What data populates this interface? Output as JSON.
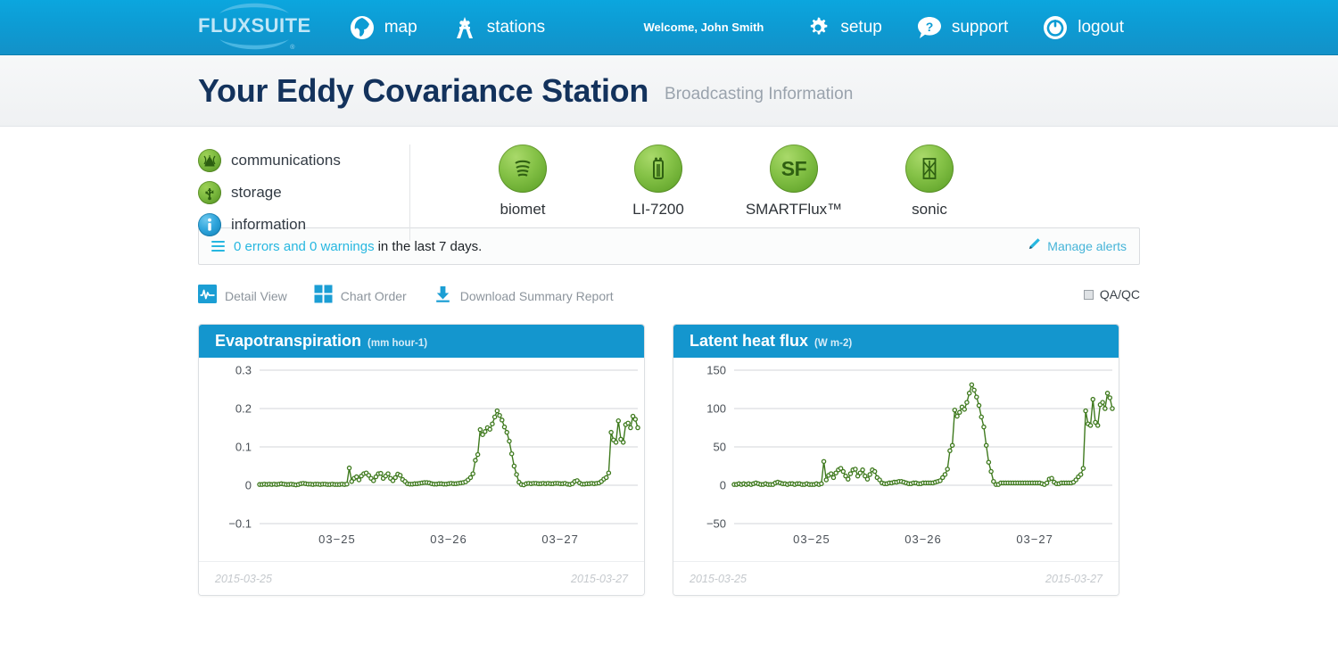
{
  "nav": {
    "logo_text": "FLUXSUITE",
    "logo_mark": "swoosh-logo",
    "items": [
      {
        "label": "map",
        "icon": "globe-icon"
      },
      {
        "label": "stations",
        "icon": "stations-icon"
      }
    ],
    "welcome": "Welcome, John Smith",
    "right_items": [
      {
        "label": "setup",
        "icon": "gear-icon"
      },
      {
        "label": "support",
        "icon": "question-bubble-icon"
      },
      {
        "label": "logout",
        "icon": "power-icon"
      }
    ]
  },
  "page": {
    "title": "Your Eddy Covariance Station",
    "subtitle": "Broadcasting Information"
  },
  "status": {
    "items": [
      {
        "label": "communications",
        "icon": "antenna-icon",
        "state_color": "#7cba3f"
      },
      {
        "label": "storage",
        "icon": "usb-icon",
        "state_color": "#7cba3f"
      },
      {
        "label": "information",
        "icon": "info-icon",
        "state_color": "#2fa5dc"
      }
    ]
  },
  "devices": [
    {
      "label": "biomet",
      "icon": "biomet-icon",
      "state_color": "#85c247"
    },
    {
      "label": "LI-7200",
      "icon": "gas-analyzer-icon",
      "state_color": "#85c247"
    },
    {
      "label": "SMARTFlux™",
      "icon": "sf-icon",
      "badge_text": "SF",
      "state_color": "#85c247"
    },
    {
      "label": "sonic",
      "icon": "sonic-anemometer-icon",
      "state_color": "#85c247"
    }
  ],
  "alerts": {
    "menu_icon": "hamburger-icon",
    "highlight": "0 errors and 0 warnings",
    "rest": "in the last 7 days.",
    "manage_icon": "pencil-icon",
    "manage_label": "Manage alerts",
    "link_color": "#27b7e0"
  },
  "toolbar": {
    "items": [
      {
        "label": "Detail View",
        "icon": "waveform-icon"
      },
      {
        "label": "Chart Order",
        "icon": "grid-squares-icon"
      },
      {
        "label": "Download Summary Report",
        "icon": "download-icon"
      }
    ],
    "qaqc_label": "QA/QC",
    "qaqc_checked": false
  },
  "chart_data": [
    {
      "type": "line",
      "title": "Evapotranspiration",
      "unit": "(mm hour-1)",
      "xlabel": "",
      "ylabel": "",
      "ylim": [
        -0.1,
        0.3
      ],
      "yticks": [
        0.3,
        0.2,
        0.1,
        0,
        -0.1
      ],
      "ytick_labels": [
        "0.3",
        "0.2",
        "0.1",
        "0",
        "−0.1"
      ],
      "xticks": [
        "03−25",
        "03−26",
        "03−27"
      ],
      "grid": true,
      "legend": "none",
      "line_color": "#3f7a1e",
      "start_date": "2015-03-25",
      "end_date": "2015-03-27",
      "values": [
        0.002,
        0.002,
        0.003,
        0.002,
        0.003,
        0.002,
        0.003,
        0.002,
        0.003,
        0.004,
        0.003,
        0.002,
        0.002,
        0.003,
        0.002,
        0.001,
        0.002,
        0.004,
        0.005,
        0.004,
        0.003,
        0.003,
        0.002,
        0.003,
        0.003,
        0.002,
        0.003,
        0.003,
        0.002,
        0.002,
        0.003,
        0.002,
        0.002,
        0.002,
        0.003,
        0.002,
        0.003,
        0.045,
        0.01,
        0.018,
        0.022,
        0.014,
        0.024,
        0.03,
        0.032,
        0.026,
        0.018,
        0.012,
        0.022,
        0.03,
        0.031,
        0.018,
        0.024,
        0.03,
        0.018,
        0.012,
        0.02,
        0.029,
        0.026,
        0.015,
        0.01,
        0.004,
        0.003,
        0.003,
        0.004,
        0.004,
        0.005,
        0.006,
        0.007,
        0.007,
        0.006,
        0.004,
        0.003,
        0.003,
        0.004,
        0.004,
        0.003,
        0.003,
        0.004,
        0.005,
        0.004,
        0.004,
        0.005,
        0.006,
        0.007,
        0.009,
        0.014,
        0.02,
        0.03,
        0.065,
        0.08,
        0.145,
        0.132,
        0.14,
        0.15,
        0.146,
        0.16,
        0.178,
        0.194,
        0.182,
        0.17,
        0.152,
        0.138,
        0.115,
        0.082,
        0.05,
        0.028,
        0.008,
        0.002,
        0.001,
        0.004,
        0.005,
        0.004,
        0.005,
        0.005,
        0.004,
        0.004,
        0.005,
        0.004,
        0.005,
        0.004,
        0.004,
        0.005,
        0.005,
        0.004,
        0.004,
        0.005,
        0.003,
        0.002,
        0.004,
        0.01,
        0.012,
        0.006,
        0.003,
        0.003,
        0.004,
        0.004,
        0.005,
        0.004,
        0.005,
        0.006,
        0.01,
        0.016,
        0.02,
        0.032,
        0.138,
        0.118,
        0.112,
        0.168,
        0.12,
        0.112,
        0.158,
        0.162,
        0.15,
        0.18,
        0.172,
        0.15
      ]
    },
    {
      "type": "line",
      "title": "Latent heat flux",
      "unit": "(W m-2)",
      "xlabel": "",
      "ylabel": "",
      "ylim": [
        -50,
        150
      ],
      "yticks": [
        150,
        100,
        50,
        0,
        -50
      ],
      "ytick_labels": [
        "150",
        "100",
        "50",
        "0",
        "−50"
      ],
      "xticks": [
        "03−25",
        "03−26",
        "03−27"
      ],
      "grid": true,
      "legend": "none",
      "line_color": "#3f7a1e",
      "start_date": "2015-03-25",
      "end_date": "2015-03-27",
      "values": [
        1,
        1,
        2,
        1,
        2,
        1,
        2,
        1,
        2,
        3,
        2,
        1,
        1,
        2,
        1,
        1,
        1,
        3,
        4,
        3,
        2,
        2,
        1,
        2,
        2,
        1,
        2,
        2,
        1,
        1,
        2,
        1,
        1,
        1,
        2,
        1,
        2,
        31,
        7,
        13,
        15,
        10,
        16,
        20,
        22,
        18,
        12,
        8,
        15,
        20,
        21,
        12,
        16,
        20,
        12,
        8,
        14,
        20,
        18,
        10,
        7,
        3,
        2,
        2,
        3,
        3,
        4,
        4,
        5,
        5,
        4,
        3,
        2,
        2,
        3,
        3,
        2,
        2,
        3,
        3,
        3,
        3,
        3,
        4,
        5,
        6,
        10,
        14,
        21,
        45,
        52,
        98,
        90,
        95,
        102,
        99,
        108,
        120,
        131,
        124,
        115,
        104,
        89,
        76,
        52,
        30,
        18,
        5,
        1,
        1,
        3,
        3,
        3,
        3,
        3,
        3,
        3,
        3,
        3,
        3,
        3,
        3,
        3,
        3,
        3,
        3,
        3,
        2,
        1,
        3,
        8,
        9,
        4,
        2,
        2,
        3,
        3,
        3,
        3,
        3,
        4,
        7,
        11,
        14,
        22,
        97,
        80,
        78,
        112,
        82,
        78,
        105,
        108,
        100,
        120,
        114,
        100
      ]
    }
  ]
}
